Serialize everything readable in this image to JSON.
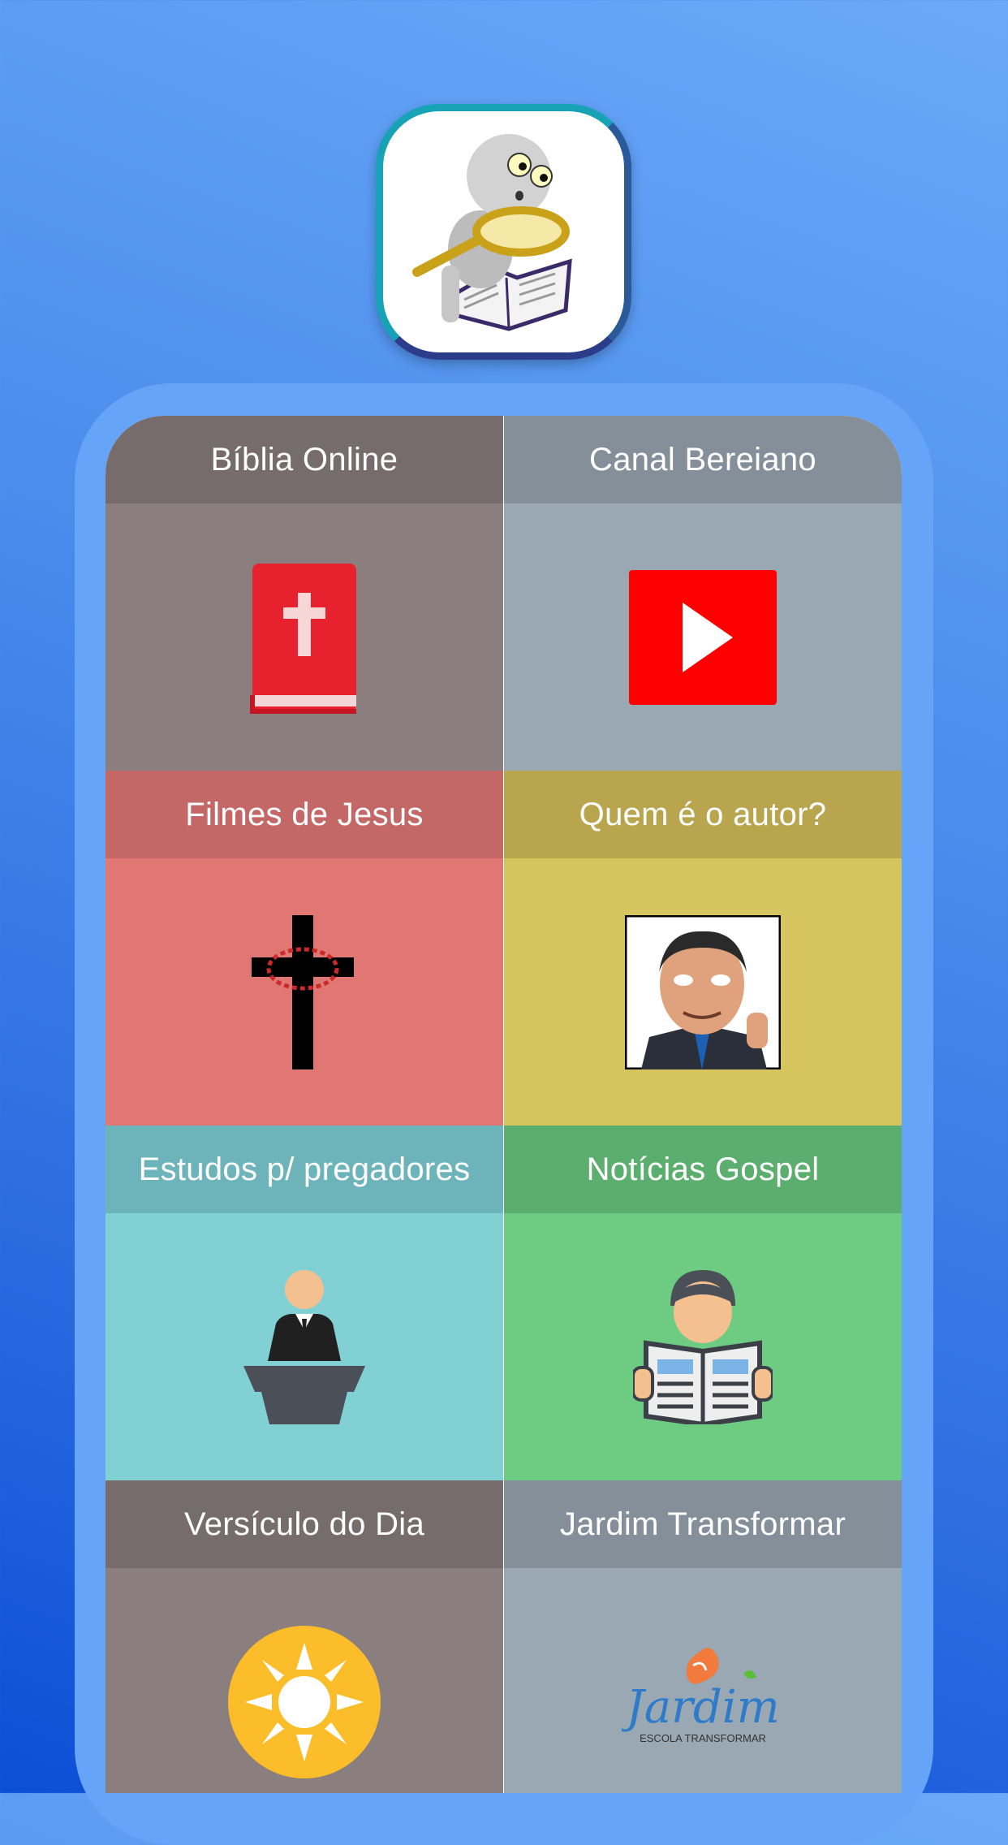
{
  "tiles": [
    {
      "label": "Bíblia Online",
      "icon": "bible-icon"
    },
    {
      "label": "Canal Bereiano",
      "icon": "youtube-play-icon"
    },
    {
      "label": "Filmes de Jesus",
      "icon": "cross-icon"
    },
    {
      "label": "Quem é o autor?",
      "icon": "author-avatar-icon"
    },
    {
      "label": "Estudos p/ pregadores",
      "icon": "preacher-icon"
    },
    {
      "label": "Notícias Gospel",
      "icon": "newspaper-reader-icon"
    },
    {
      "label": "Versículo do Dia",
      "icon": "sun-icon"
    },
    {
      "label": "Jardim Transformar",
      "icon": "jardim-logo-icon"
    }
  ],
  "jardim_logo": {
    "title": "Jardim",
    "subtitle": "ESCOLA TRANSFORMAR"
  },
  "app_icon": "magnifier-bible-app-icon"
}
